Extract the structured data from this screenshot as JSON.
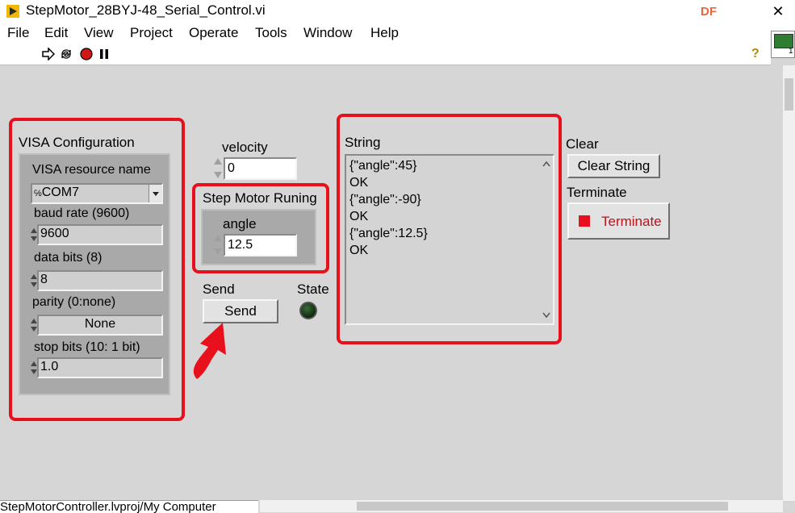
{
  "window": {
    "title": "StepMotor_28BYJ-48_Serial_Control.vi",
    "logo_text": "DF",
    "close_glyph": "✕"
  },
  "menu": [
    "File",
    "Edit",
    "View",
    "Project",
    "Operate",
    "Tools",
    "Window",
    "Help"
  ],
  "toolbar": {
    "icons": [
      "run-arrow-icon",
      "run-continuously-icon",
      "abort-icon",
      "pause-icon"
    ],
    "help_glyph": "?",
    "vi_icon_number": "1"
  },
  "visa": {
    "title": "VISA Configuration",
    "resource_label": "VISA resource name",
    "resource_value": "COM7",
    "resource_prefix": "℅",
    "baud_label": "baud rate (9600)",
    "baud_value": "9600",
    "databits_label": "data bits (8)",
    "databits_value": "8",
    "parity_label": "parity (0:none)",
    "parity_value": "None",
    "stopbits_label": "stop bits (10: 1 bit)",
    "stopbits_value": "1.0"
  },
  "velocity": {
    "label": "velocity",
    "value": "0"
  },
  "running": {
    "title": "Step Motor Runing",
    "angle_label": "angle",
    "angle_value": "12.5"
  },
  "send": {
    "label": "Send",
    "button": "Send"
  },
  "state": {
    "label": "State"
  },
  "string_display": {
    "label": "String",
    "lines": [
      "{\"angle\":45}",
      "OK",
      "{\"angle\":-90}",
      "OK",
      "{\"angle\":12.5}",
      "OK"
    ]
  },
  "clear": {
    "label": "Clear",
    "button": "Clear String"
  },
  "terminate": {
    "label": "Terminate",
    "button": "Terminate"
  },
  "statusbar": {
    "path": "StepMotorController.lvproj/My Computer"
  },
  "colors": {
    "highlight": "#e8101c",
    "accent_terminate_text": "#c0101a"
  }
}
